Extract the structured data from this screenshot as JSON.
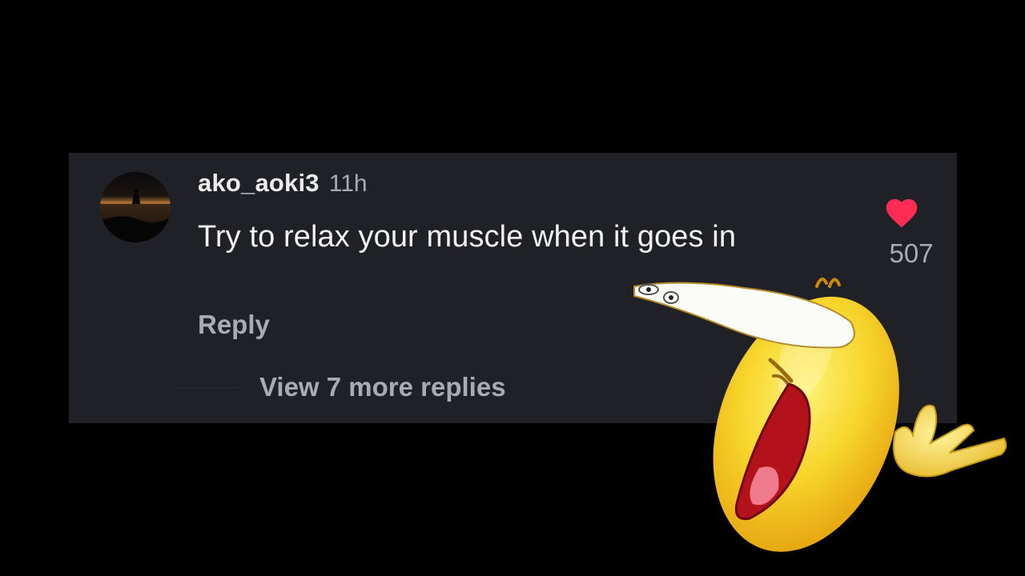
{
  "comment": {
    "username": "ako_aoki3",
    "timestamp": "11h",
    "text": "Try to relax your muscle when it goes in",
    "reply_label": "Reply",
    "likes": "507",
    "view_replies_label": "View 7 more replies"
  },
  "icons": {
    "like": "heart-icon",
    "avatar": "avatar",
    "overlay": "laughing-emoji-icon"
  },
  "colors": {
    "background": "#000000",
    "card": "#202126",
    "heart": "#fe2c55",
    "emoji": "#f3c322"
  }
}
